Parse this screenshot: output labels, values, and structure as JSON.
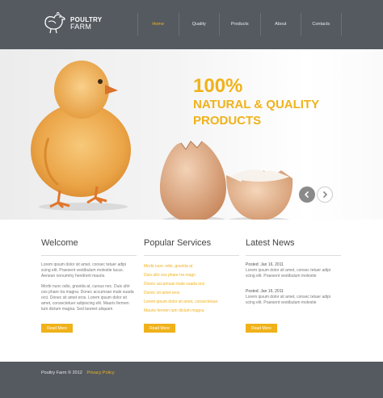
{
  "header": {
    "logo": {
      "line1": "POULTRY",
      "line2": "FARM"
    },
    "nav": [
      {
        "label": "Home",
        "active": true
      },
      {
        "label": "Quality"
      },
      {
        "label": "Products"
      },
      {
        "label": "About"
      },
      {
        "label": "Contacts"
      }
    ]
  },
  "hero": {
    "line1": "100%",
    "line2": "NATURAL & QUALITY",
    "line3": "PRODUCTS",
    "prev_icon": "chevron-left-icon",
    "next_icon": "chevron-right-icon"
  },
  "welcome": {
    "title": "Welcome",
    "para1": "Lorem ipsum dolor sit amet, consec tetuer adipi scing elit. Praesent vestibulum molestie lacus. Aenean nonummy hendrerit mauris.",
    "para2": "Morbi nunc odio, gravida at, cursus nec. Duis ultri ces phare tra magna. Donec accumsan male suada orci. Donec sit amet eros. Lorem ipsum dolor sit amet, consectetuer adipiscing elit. Mauris fermen tum dictum magna. Sed laoreet aliquam",
    "button": "Read More"
  },
  "services": {
    "title": "Popular Services",
    "items": [
      "Morbi nunc odio, gravida at",
      "Duis ultri  ces phare tra magn",
      "Donec accumsan male suada orci",
      "Donec sit amet eros",
      "Lorem ipsum dolor sit amet, consectetuer",
      "Mauris fermen tum dictum magna"
    ],
    "button": "Read More"
  },
  "news": {
    "title": "Latest News",
    "items": [
      {
        "date": "Posted: Jan 16, 2011",
        "text": "Lorem ipsum dolor sit amet, consec tetuer adipi scing elit. Praesent vestibulum molestie"
      },
      {
        "date": "Posted: Jan 16, 2011",
        "text": "Lorem ipsum dolor sit amet, consec tetuer adipi scing elit. Praesent vestibulum molestie"
      }
    ],
    "button": "Read More"
  },
  "footer": {
    "copyright": "Poultry Farm © 2012",
    "link": "Privacy Policy"
  },
  "colors": {
    "accent": "#f0b21a",
    "header_bg": "#555a61",
    "footer_bg": "#555a61"
  }
}
